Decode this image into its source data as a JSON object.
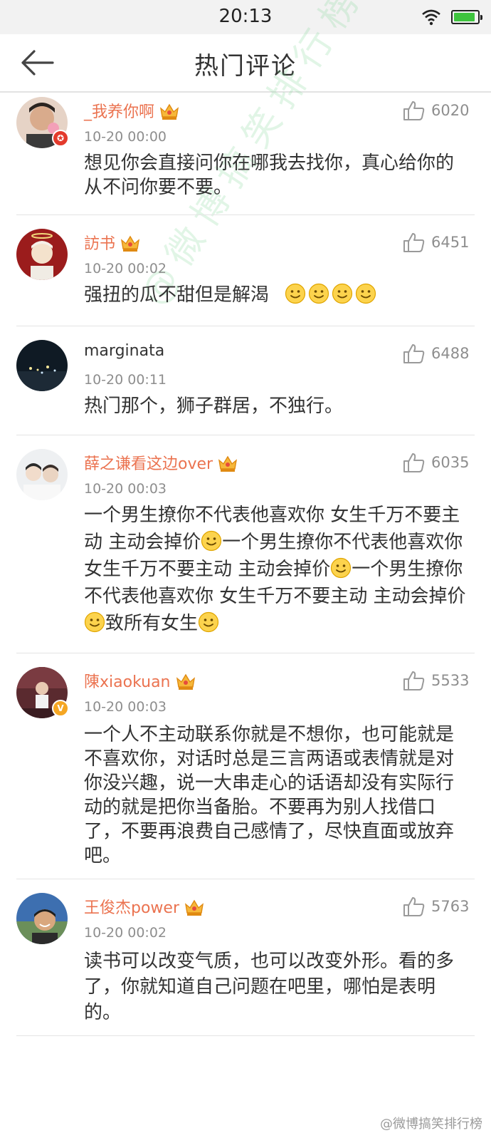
{
  "status_bar": {
    "time": "20:13"
  },
  "nav": {
    "title": "热门评论"
  },
  "comments": [
    {
      "username": "_我养你啊",
      "time": "10-20 00:00",
      "likes": "6020",
      "text": "想见你会直接问你在哪我去找你，真心给你的从不问你要不要。"
    },
    {
      "username": "訪书",
      "time": "10-20 00:02",
      "likes": "6451",
      "text": "强扭的瓜不甜但是解渴"
    },
    {
      "username": "marginata",
      "time": "10-20 00:11",
      "likes": "6488",
      "text": "热门那个，狮子群居，不独行。"
    },
    {
      "username": "薛之谦看这边over",
      "time": "10-20 00:03",
      "likes": "6035",
      "text_parts": [
        "一个男生撩你不代表他喜欢你 女生千万不要主动 主动会掉价",
        "一个男生撩你不代表他喜欢你 女生千万不要主动 主动会掉价",
        "一个男生撩你不代表他喜欢你 女生千万不要主动 主动会掉价",
        "致所有女生"
      ]
    },
    {
      "username": "陳xiaokuan",
      "time": "10-20 00:03",
      "likes": "5533",
      "text": "一个人不主动联系你就是不想你，也可能就是不喜欢你，对话时总是三言两语或表情就是对你没兴趣，说一大串走心的话语却没有实际行动的就是把你当备胎。不要再为别人找借口了，不要再浪费自己感情了，尽快直面或放弃吧。"
    },
    {
      "username": "王俊杰power",
      "time": "10-20 00:02",
      "likes": "5763",
      "text": "读书可以改变气质，也可以改变外形。看的多了，你就知道自己问题在吧里，哪怕是表明的。"
    }
  ],
  "watermark": "@微博搞笑排行榜",
  "watermark_bottom": "@微博搞笑排行榜",
  "icons": {
    "back": "back-arrow-icon",
    "like": "thumbs-up-icon",
    "crown": "vip-crown-icon",
    "emoji": "smile-emoji-icon",
    "wifi": "wifi-icon",
    "battery": "battery-icon"
  },
  "colors": {
    "username": "#eb7350",
    "meta": "#8e8e8e",
    "text": "#333333",
    "battery": "#3ec43e"
  },
  "battery_level": 0.9
}
